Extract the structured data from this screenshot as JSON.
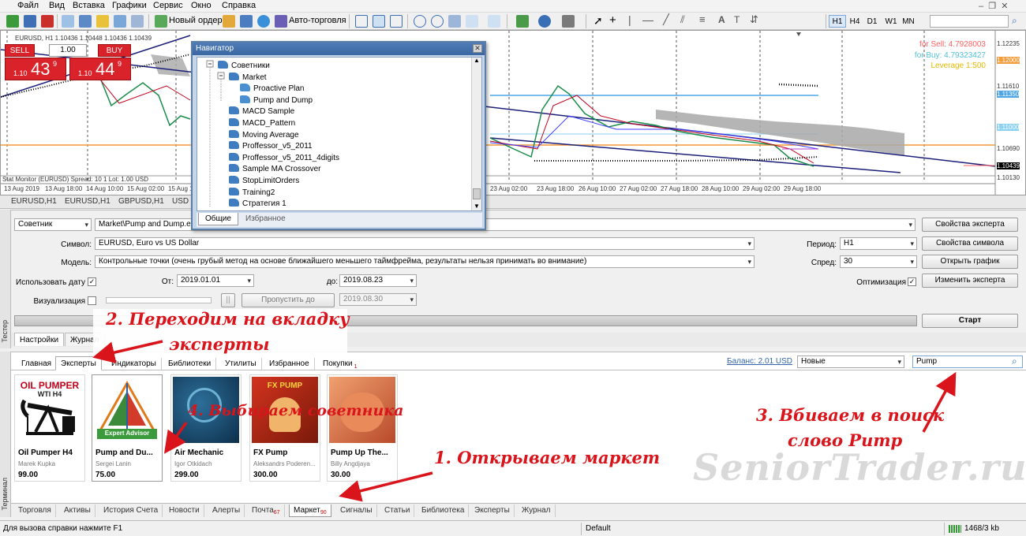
{
  "menu": [
    "Файл",
    "Вид",
    "Вставка",
    "Графики",
    "Сервис",
    "Окно",
    "Справка"
  ],
  "toolbar": {
    "new_order": "Новый ордер",
    "auto_trading": "Авто-торговля",
    "timeframes": [
      "H1",
      "H4",
      "D1",
      "W1",
      "MN"
    ],
    "selected_timeframe": "H1"
  },
  "chart": {
    "header": "EURUSD, H1 1.10436 1.10448 1.10436 1.10439",
    "sell_label": "SELL",
    "buy_label": "BUY",
    "lot": "1.00",
    "sell_small": "1.10",
    "sell_big": "43",
    "sell_sup": "9",
    "buy_small": "1.10",
    "buy_big": "44",
    "buy_sup": "9",
    "for_sell": "for Sell: 4.7928003",
    "for_buy": "for Buy: 4.79323427",
    "leverage": "Leverage 1:500",
    "footer": "Stat Monitor (EURUSD)  Spread: 10  1 Lot: 1.00 USD",
    "yaxis": [
      "1.12235",
      "1.12000",
      "1.11610",
      "1.11350",
      "1.11000",
      "1.10690",
      "1.10439",
      "1.10130"
    ],
    "xaxis": [
      "13 Aug 2019",
      "13 Aug 18:00",
      "14 Aug 10:00",
      "15 Aug 02:00",
      "15 Aug 18:00",
      "23 Aug 02:00",
      "23 Aug 18:00",
      "26 Aug 10:00",
      "27 Aug 02:00",
      "27 Aug 18:00",
      "28 Aug 10:00",
      "29 Aug 02:00",
      "29 Aug 18:00"
    ],
    "colors": {
      "sell_line": "#ff6060",
      "buy_line": "#4ec1d8",
      "leverage": "#e6b800",
      "trend": "#1b1f7a",
      "red_button": "#d9222a"
    }
  },
  "chart_tabs": [
    "EURUSD,H1",
    "EURUSD,H1",
    "GBPUSD,H1",
    "USD"
  ],
  "navigator": {
    "title": "Навигатор",
    "items": [
      {
        "label": "Советники",
        "level": 0
      },
      {
        "label": "Market",
        "level": 1
      },
      {
        "label": "Proactive Plan",
        "level": 2
      },
      {
        "label": "Pump and Dump",
        "level": 2
      },
      {
        "label": "MACD Sample",
        "level": 1
      },
      {
        "label": "MACD_Pattern",
        "level": 1
      },
      {
        "label": "Moving Average",
        "level": 1
      },
      {
        "label": "Proffessor_v5_2011",
        "level": 1
      },
      {
        "label": "Proffessor_v5_2011_4digits",
        "level": 1
      },
      {
        "label": "Sample MA Crossover",
        "level": 1
      },
      {
        "label": "StopLimitOrders",
        "level": 1
      },
      {
        "label": "Training2",
        "level": 1
      },
      {
        "label": "Стратегия 1",
        "level": 1
      }
    ],
    "tabs": [
      "Общие",
      "Избранное"
    ]
  },
  "tester": {
    "side_label": "Тестер",
    "type": "Советник",
    "expert": "Market\\Pump and Dump.ex4",
    "symbol_label": "Символ:",
    "symbol": "EURUSD, Euro vs US Dollar",
    "model_label": "Модель:",
    "model": "Контрольные точки (очень грубый метод на основе ближайшего меньшего таймфрейма, результаты нельзя принимать во внимание)",
    "use_date": "Использовать дату",
    "from_label": "От:",
    "from": "2019.01.01",
    "to_label": "до:",
    "to": "2019.08.23",
    "visual": "Визуализация",
    "skip_to": "Пропустить до",
    "skip_date": "2019.08.30",
    "period_label": "Период:",
    "period": "H1",
    "spread_label": "Спред:",
    "spread": "30",
    "optimization": "Оптимизация",
    "buttons": {
      "expert_props": "Свойства эксперта",
      "symbol_props": "Свойства символа",
      "open_chart": "Открыть график",
      "edit_expert": "Изменить эксперта",
      "start": "Старт"
    },
    "tabs": [
      "Настройки",
      "Журнал"
    ]
  },
  "market": {
    "side_label": "Терминал",
    "tabs": [
      "Главная",
      "Эксперты",
      "Индикаторы",
      "Библиотеки",
      "Утилиты",
      "Избранное",
      "Покупки"
    ],
    "purchases_badge": "1",
    "balance": "Баланс: 2.01 USD",
    "sort": "Новые",
    "search": "Pump",
    "products": [
      {
        "name": "Oil Pumper H4",
        "author": "Marek Kupka",
        "price": "99.00",
        "art_title": "OIL PUMPER",
        "art_sub": "WTI H4"
      },
      {
        "name": "Pump and Du...",
        "author": "Sergei Lanin",
        "price": "75.00",
        "art_title": "Expert Advisor"
      },
      {
        "name": "Air Mechanic",
        "author": "Igor Otkidach",
        "price": "299.00"
      },
      {
        "name": "FX Pump",
        "author": "Aleksandrs Poderen...",
        "price": "300.00",
        "art_title": "FX PUMP"
      },
      {
        "name": "Pump Up The...",
        "author": "Billy Angdjaya",
        "price": "30.00"
      }
    ]
  },
  "bottom_tabs": [
    {
      "label": "Торговля"
    },
    {
      "label": "Активы"
    },
    {
      "label": "История Счета"
    },
    {
      "label": "Новости"
    },
    {
      "label": "Алерты"
    },
    {
      "label": "Почта",
      "badge": "67"
    },
    {
      "label": "Маркет",
      "badge": "90"
    },
    {
      "label": "Сигналы"
    },
    {
      "label": "Статьи"
    },
    {
      "label": "Библиотека"
    },
    {
      "label": "Эксперты"
    },
    {
      "label": "Журнал"
    }
  ],
  "status": {
    "help": "Для вызова справки нажмите F1",
    "profile": "Default",
    "traffic": "1468/3 kb"
  },
  "annotations": {
    "step1": "1. Открываем маркет",
    "step2a": "2. Переходим на вкладку",
    "step2b": "эксперты",
    "step3a": "3. Вбиваем в поиск",
    "step3b": "слово Pump",
    "step4": "4. Выбираем советника",
    "watermark": "SeniorTrader.ru"
  }
}
